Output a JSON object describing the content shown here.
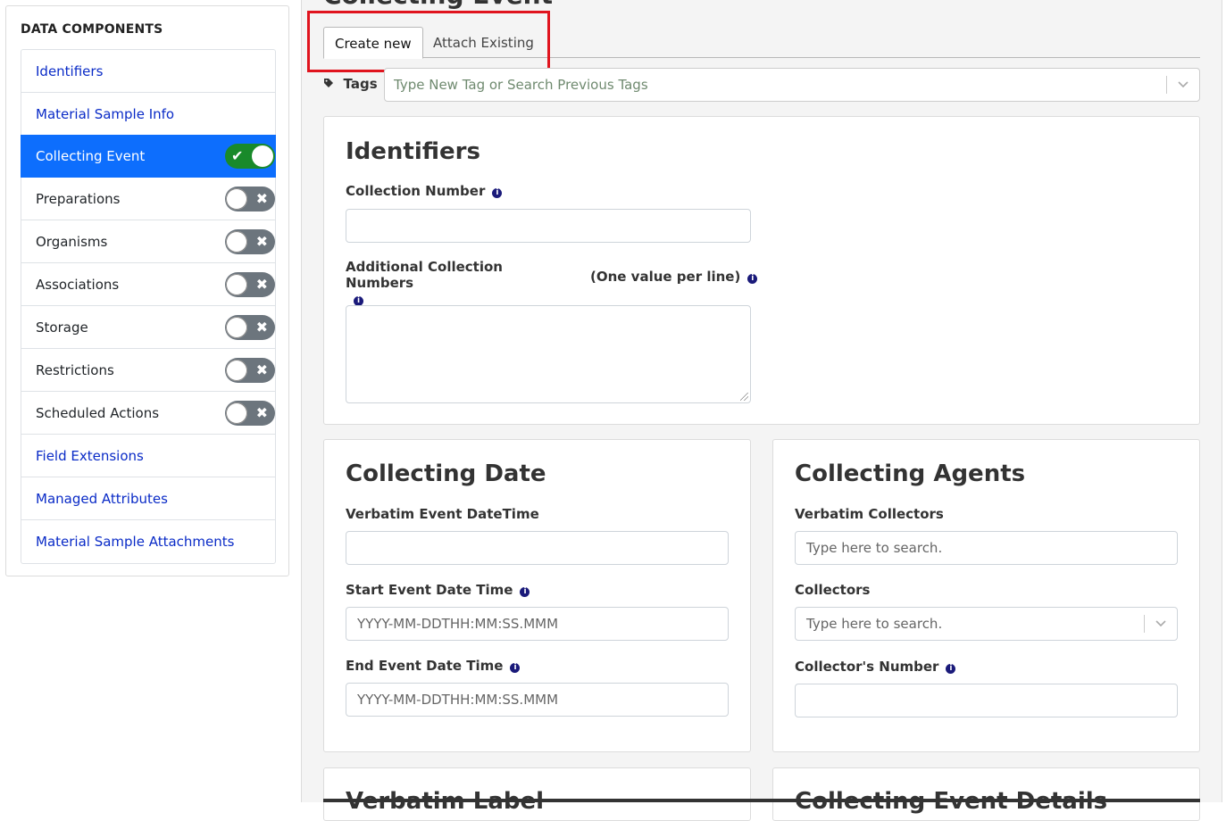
{
  "sidebar": {
    "title": "DATA COMPONENTS",
    "items": [
      {
        "label": "Identifiers"
      },
      {
        "label": "Material Sample Info"
      },
      {
        "label": "Collecting Event"
      },
      {
        "label": "Preparations"
      },
      {
        "label": "Organisms"
      },
      {
        "label": "Associations"
      },
      {
        "label": "Storage"
      },
      {
        "label": "Restrictions"
      },
      {
        "label": "Scheduled Actions"
      },
      {
        "label": "Field Extensions"
      },
      {
        "label": "Managed Attributes"
      },
      {
        "label": "Material Sample Attachments"
      }
    ]
  },
  "main": {
    "heading": "Collecting Event",
    "tabs": [
      {
        "label": "Create new"
      },
      {
        "label": "Attach Existing"
      }
    ],
    "tags": {
      "label": "Tags",
      "placeholder": "Type New Tag or Search Previous Tags"
    },
    "identifiers": {
      "title": "Identifiers",
      "collection_number_label": "Collection Number",
      "additional_label": "Additional Collection Numbers",
      "additional_hint": "(One value per line)"
    },
    "collecting_date": {
      "title": "Collecting Date",
      "verbatim_label": "Verbatim Event DateTime",
      "start_label": "Start Event Date Time",
      "start_placeholder": "YYYY-MM-DDTHH:MM:SS.MMM",
      "end_label": "End Event Date Time",
      "end_placeholder": "YYYY-MM-DDTHH:MM:SS.MMM"
    },
    "collecting_agents": {
      "title": "Collecting Agents",
      "verbatim_label": "Verbatim Collectors",
      "verbatim_placeholder": "Type here to search.",
      "collectors_label": "Collectors",
      "collectors_placeholder": "Type here to search.",
      "collector_number_label": "Collector's Number"
    },
    "verbatim_label_card": {
      "title": "Verbatim Label"
    },
    "event_details_card": {
      "title": "Collecting Event Details"
    }
  },
  "icons": {
    "check": "✔",
    "cross": "✖",
    "info": "i",
    "tag": "tag-icon",
    "chevron": "⌄"
  },
  "colors": {
    "active_blue": "#0d6efd",
    "toggle_on": "#198a2a",
    "toggle_off": "#6c757d",
    "highlight": "#e0141e"
  }
}
